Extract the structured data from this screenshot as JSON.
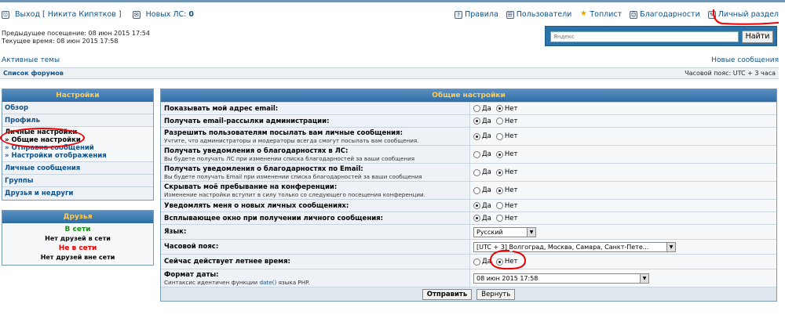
{
  "nav": {
    "logout": "Выход [ Никита Кипятков ]",
    "new_pm": "Новых ЛС:",
    "new_pm_count": "0",
    "rules": "Правила",
    "users": "Пользователи",
    "toplist": "Топлист",
    "thanks": "Благодарности",
    "personal": "Личный раздел"
  },
  "visits": {
    "prev": "Предыдущее посещение: 08 июн 2015 17:54",
    "now": "Текущее время: 08 июн 2015 17:58"
  },
  "search": {
    "placeholder": "Яндекс",
    "button": "Найти"
  },
  "links": {
    "active_topics": "Активные темы",
    "new_messages": "Новые сообщения"
  },
  "forumbar": {
    "left": "Список форумов",
    "right": "Часовой пояс: UTC + 3 часа"
  },
  "settings_panel": {
    "title": "Настройки",
    "overview": "Обзор",
    "profile": "Профиль",
    "personal": "Личные настройки",
    "general": "» Общие настройки",
    "posting": "» Отправка сообщений",
    "display": "» Настройки отображения",
    "pm": "Личные сообщения",
    "groups": "Группы",
    "friends_foes": "Друзья и недруги"
  },
  "friends_panel": {
    "title": "Друзья",
    "online": "В сети",
    "online_none": "Нет друзей в сети",
    "offline": "Не в сети",
    "offline_none": "Нет друзей вне сети"
  },
  "main": {
    "title": "Общие настройки",
    "yes": "Да",
    "no": "Нет",
    "rows": [
      {
        "t": "Показывать мой адрес email:",
        "d": "",
        "val": "no"
      },
      {
        "t": "Получать email-рассылки администрации:",
        "d": "",
        "val": "yes"
      },
      {
        "t": "Разрешить пользователям посылать вам личные сообщения:",
        "d": "Учтите, что администраторы и модераторы всегда смогут посылать вам сообщения.",
        "val": "yes"
      },
      {
        "t": "Получать уведомления о благодарностях в ЛС:",
        "d": "Вы будете получать ЛС при изменении списка благодарностей за ваши сообщения",
        "val": "no"
      },
      {
        "t": "Получать уведомления о благодарностях по Email:",
        "d": "Вы будете получать Email при изменении списка благодарностей за ваши сообщения",
        "val": "no"
      },
      {
        "t": "Скрывать моё пребывание на конференции:",
        "d": "Изменение настройки вступит в силу только со следующего посещения конференции.",
        "val": "no"
      },
      {
        "t": "Уведомлять меня о новых личных сообщениях:",
        "d": "",
        "val": "yes"
      },
      {
        "t": "Всплывающее окно при получении личного сообщения:",
        "d": "",
        "val": "yes"
      }
    ],
    "lang_label": "Язык:",
    "lang_value": "Русский",
    "tz_label": "Часовой пояс:",
    "tz_value": "[UTC + 3] Волгоград, Москва, Самара, Санкт-Пете...",
    "dst_label": "Сейчас действует летнее время:",
    "dst_val": "no",
    "date_label": "Формат даты:",
    "date_desc_pre": "Синтаксис идентичен функции",
    "date_desc_link": "date()",
    "date_desc_post": "языка PHP.",
    "date_value": "08 июн 2015 17:58",
    "submit": "Отправить",
    "reset": "Вернуть"
  },
  "colors": {
    "accent": "#2e6ea6",
    "header_text": "#ffcc55",
    "annotation": "#e00000"
  }
}
